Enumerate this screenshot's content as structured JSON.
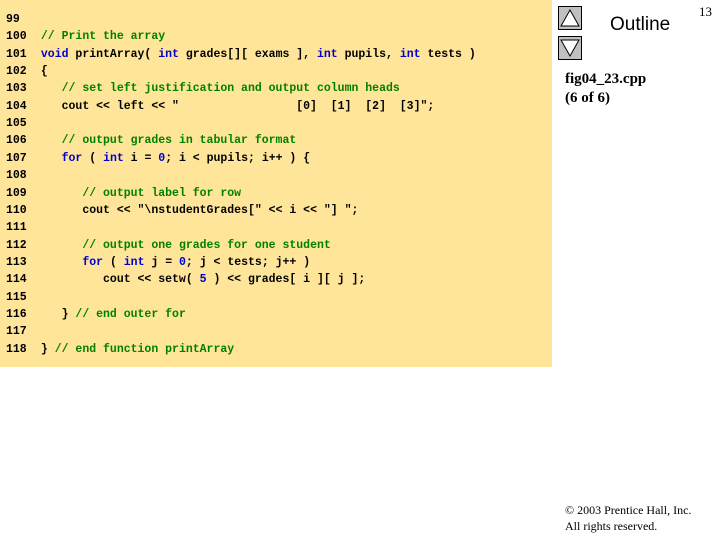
{
  "slide_number": "13",
  "outline_title": "Outline",
  "nav": {
    "up_icon": "triangle-up-icon",
    "down_icon": "triangle-down-icon"
  },
  "file_label": {
    "name": "fig04_23.cpp",
    "page": "(6 of 6)"
  },
  "copyright": {
    "line1": "© 2003 Prentice Hall, Inc.",
    "line2": "All rights reserved."
  },
  "colors": {
    "code_background": "#ffe599",
    "comment": "#008000",
    "keyword": "#0000cc"
  },
  "code": [
    {
      "n": "99",
      "parts": []
    },
    {
      "n": "100",
      "parts": [
        {
          "t": "// Print the array",
          "c": "cm"
        }
      ]
    },
    {
      "n": "101",
      "parts": [
        {
          "t": "void",
          "c": "kw"
        },
        {
          "t": " printArray( ",
          "c": ""
        },
        {
          "t": "int",
          "c": "kw"
        },
        {
          "t": " grades[][ exams ], ",
          "c": ""
        },
        {
          "t": "int",
          "c": "kw"
        },
        {
          "t": " pupils, ",
          "c": ""
        },
        {
          "t": "int",
          "c": "kw"
        },
        {
          "t": " tests )",
          "c": ""
        }
      ]
    },
    {
      "n": "102",
      "parts": [
        {
          "t": "{",
          "c": ""
        }
      ]
    },
    {
      "n": "103",
      "parts": [
        {
          "t": "   ",
          "c": ""
        },
        {
          "t": "// set left justification and output column heads",
          "c": "cm"
        }
      ]
    },
    {
      "n": "104",
      "parts": [
        {
          "t": "   cout << left << ",
          "c": ""
        },
        {
          "t": "\"                 [0]  [1]  [2]  [3]\"",
          "c": "st"
        },
        {
          "t": ";",
          "c": ""
        }
      ]
    },
    {
      "n": "105",
      "parts": []
    },
    {
      "n": "106",
      "parts": [
        {
          "t": "   ",
          "c": ""
        },
        {
          "t": "// output grades in tabular format",
          "c": "cm"
        }
      ]
    },
    {
      "n": "107",
      "parts": [
        {
          "t": "   ",
          "c": ""
        },
        {
          "t": "for",
          "c": "kw"
        },
        {
          "t": " ( ",
          "c": ""
        },
        {
          "t": "int",
          "c": "kw"
        },
        {
          "t": " i = ",
          "c": ""
        },
        {
          "t": "0",
          "c": "kw"
        },
        {
          "t": "; i < pupils; i++ ) {",
          "c": ""
        }
      ]
    },
    {
      "n": "108",
      "parts": []
    },
    {
      "n": "109",
      "parts": [
        {
          "t": "      ",
          "c": ""
        },
        {
          "t": "// output label for row",
          "c": "cm"
        }
      ]
    },
    {
      "n": "110",
      "parts": [
        {
          "t": "      cout << ",
          "c": ""
        },
        {
          "t": "\"\\nstudentGrades[\"",
          "c": "st"
        },
        {
          "t": " << i << ",
          "c": ""
        },
        {
          "t": "\"] \"",
          "c": "st"
        },
        {
          "t": ";",
          "c": ""
        }
      ]
    },
    {
      "n": "111",
      "parts": []
    },
    {
      "n": "112",
      "parts": [
        {
          "t": "      ",
          "c": ""
        },
        {
          "t": "// output one grades for one student",
          "c": "cm"
        }
      ]
    },
    {
      "n": "113",
      "parts": [
        {
          "t": "      ",
          "c": ""
        },
        {
          "t": "for",
          "c": "kw"
        },
        {
          "t": " ( ",
          "c": ""
        },
        {
          "t": "int",
          "c": "kw"
        },
        {
          "t": " j = ",
          "c": ""
        },
        {
          "t": "0",
          "c": "kw"
        },
        {
          "t": "; j < tests; j++ )",
          "c": ""
        }
      ]
    },
    {
      "n": "114",
      "parts": [
        {
          "t": "         cout << setw( ",
          "c": ""
        },
        {
          "t": "5",
          "c": "kw"
        },
        {
          "t": " ) << grades[ i ][ j ];",
          "c": ""
        }
      ]
    },
    {
      "n": "115",
      "parts": []
    },
    {
      "n": "116",
      "parts": [
        {
          "t": "   } ",
          "c": ""
        },
        {
          "t": "// end outer for",
          "c": "cm"
        }
      ]
    },
    {
      "n": "117",
      "parts": []
    },
    {
      "n": "118",
      "parts": [
        {
          "t": "} ",
          "c": ""
        },
        {
          "t": "// end function printArray",
          "c": "cm"
        }
      ]
    }
  ]
}
